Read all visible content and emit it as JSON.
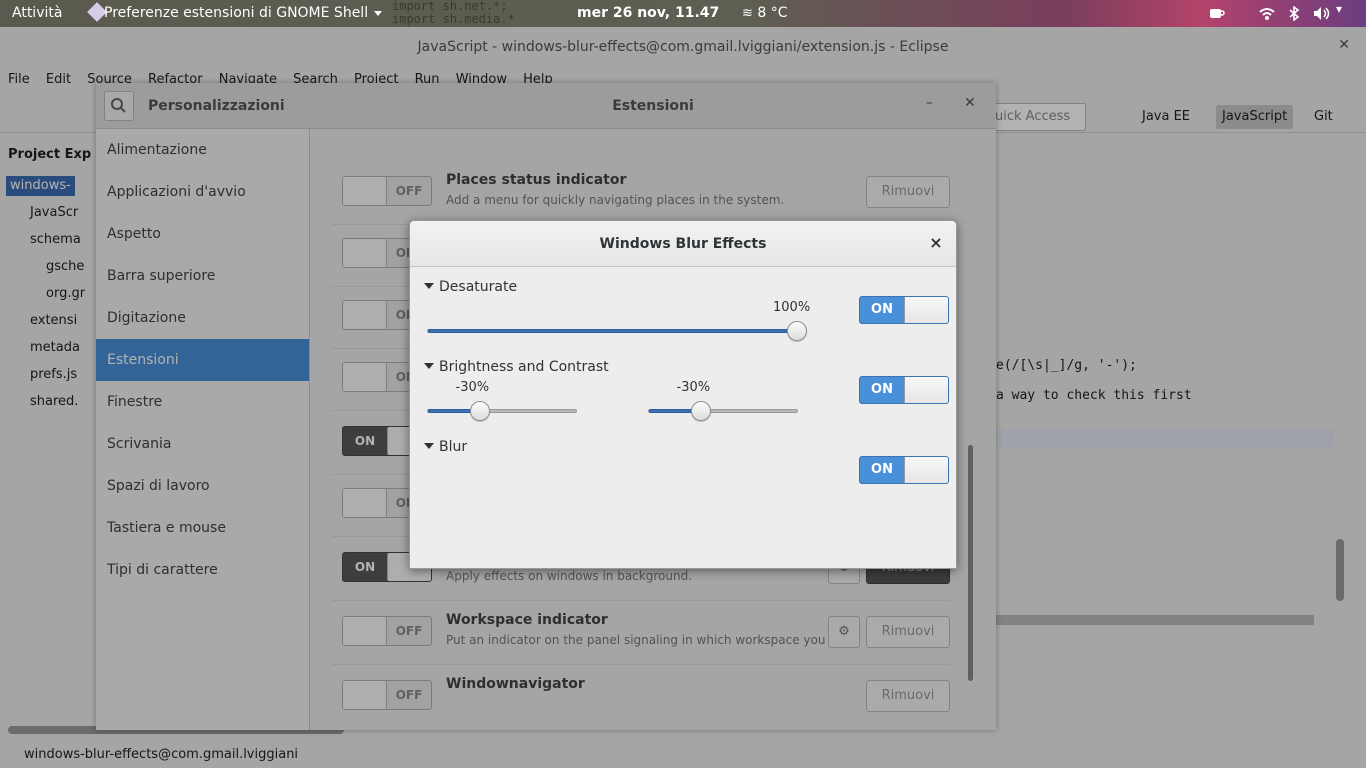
{
  "topbar": {
    "activities": "Attività",
    "app_menu": "Preferenze estensioni di GNOME Shell",
    "clock": "mer 26 nov, 11.47",
    "weather": "8 °C",
    "code_bg_1": "import sh.net.*;",
    "code_bg_2": "import sh.media.*"
  },
  "eclipse": {
    "title": "JavaScript - windows-blur-effects@com.gmail.lviggiani/extension.js - Eclipse",
    "menus": [
      "File",
      "Edit",
      "Source",
      "Refactor",
      "Navigate",
      "Search",
      "Project",
      "Run",
      "Window",
      "Help"
    ],
    "quick_access": "uick Access",
    "perspectives": [
      "Java EE",
      "JavaScript",
      "Git"
    ],
    "project_explorer": "Project Exp",
    "tree": [
      "windows-",
      "JavaScr",
      "schema",
      "gsche",
      "org.gr",
      "extensi",
      "metada",
      "prefs.js",
      "shared."
    ],
    "code_line_1": "e(/[\\s|_]/g, '-');",
    "code_line_2": "a way to check this first",
    "status": "windows-blur-effects@com.gmail.lviggiani"
  },
  "prefs": {
    "left_title": "Personalizzazioni",
    "center_title": "Estensioni",
    "sidebar": [
      "Alimentazione",
      "Applicazioni d'avvio",
      "Aspetto",
      "Barra superiore",
      "Digitazione",
      "Estensioni",
      "Finestre",
      "Scrivania",
      "Spazi di lavoro",
      "Tastiera e mouse",
      "Tipi di carattere"
    ],
    "rows": [
      {
        "state": "OFF",
        "name": "Places status indicator",
        "desc": "Add a menu for quickly navigating places in the system.",
        "remove": "Rimuovi"
      },
      {
        "state": "OFF",
        "name": "",
        "desc": "",
        "remove": ""
      },
      {
        "state": "OFF",
        "name": "",
        "desc": "",
        "remove": ""
      },
      {
        "state": "OFF",
        "name": "",
        "desc": "",
        "remove": ""
      },
      {
        "state": "ON",
        "name": "",
        "desc": "",
        "remove": ""
      },
      {
        "state": "OFF",
        "name": "",
        "desc": "",
        "remove": ""
      },
      {
        "state": "ON",
        "name": "",
        "desc": "Apply effects on windows in background.",
        "remove": "Rimuovi"
      },
      {
        "state": "OFF",
        "name": "Workspace indicator",
        "desc": "Put an indicator on the panel signaling in which workspace you ar...",
        "remove": "Rimuovi"
      },
      {
        "state": "OFF",
        "name": "Windownavigator",
        "desc": "",
        "remove": "Rimuovi"
      }
    ]
  },
  "dialog": {
    "title": "Windows Blur Effects",
    "close": "×",
    "desaturate": {
      "label": "Desaturate",
      "value_text": "100%",
      "value": 1.0,
      "switch": "ON"
    },
    "brightness_contrast": {
      "label": "Brightness and Contrast",
      "brightness_text": "-30%",
      "brightness": 0.35,
      "contrast_text": "-30%",
      "contrast": 0.35,
      "switch": "ON"
    },
    "blur": {
      "label": "Blur",
      "switch": "ON"
    }
  },
  "colors": {
    "accent": "#4a90d9",
    "fill": "#3d6fb5"
  }
}
